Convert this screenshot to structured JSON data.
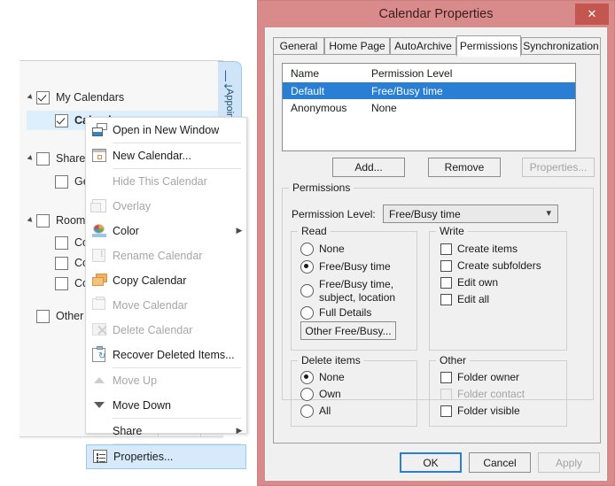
{
  "nav_pane": {
    "peek_tab": {
      "label": "Appointment",
      "arrow_icon": "collapse-left-arrow"
    },
    "tree": [
      {
        "label": "My Calendars",
        "level": 0,
        "expander": true,
        "checked": true,
        "selected": false
      },
      {
        "label": "Calendar",
        "level": 1,
        "expander": false,
        "checked": true,
        "selected": true
      },
      {
        "label": "Shared C",
        "level": 0,
        "expander": true,
        "checked": false,
        "selected": false
      },
      {
        "label": "Geme",
        "level": 1,
        "expander": false,
        "checked": false,
        "selected": false
      },
      {
        "label": "Rooms",
        "level": 0,
        "expander": true,
        "checked": false,
        "selected": false
      },
      {
        "label": "Conf",
        "level": 1,
        "expander": false,
        "checked": false,
        "selected": false
      },
      {
        "label": "Conf",
        "level": 1,
        "expander": false,
        "checked": false,
        "selected": false
      },
      {
        "label": "Conf",
        "level": 1,
        "expander": false,
        "checked": false,
        "selected": false
      },
      {
        "label": "Other Ca",
        "level": 0,
        "expander": false,
        "checked": false,
        "selected": false
      }
    ]
  },
  "context_menu": {
    "items": [
      {
        "label": "Open in New Window",
        "icon": "open-in-new-window-icon",
        "enabled": true,
        "submenu": false,
        "highlight": false
      },
      {
        "label": "New Calendar...",
        "icon": "new-calendar-icon",
        "enabled": true,
        "submenu": false,
        "highlight": false
      },
      {
        "label": "Hide This Calendar",
        "icon": "none",
        "enabled": false,
        "submenu": false,
        "highlight": false
      },
      {
        "label": "Overlay",
        "icon": "overlay-icon",
        "enabled": false,
        "submenu": false,
        "highlight": false
      },
      {
        "label": "Color",
        "icon": "color-palette-icon",
        "enabled": true,
        "submenu": true,
        "highlight": false
      },
      {
        "label": "Rename Calendar",
        "icon": "rename-icon",
        "enabled": false,
        "submenu": false,
        "highlight": false
      },
      {
        "label": "Copy Calendar",
        "icon": "copy-folder-icon",
        "enabled": true,
        "submenu": false,
        "highlight": false
      },
      {
        "label": "Move Calendar",
        "icon": "move-folder-icon",
        "enabled": false,
        "submenu": false,
        "highlight": false
      },
      {
        "label": "Delete Calendar",
        "icon": "delete-folder-icon",
        "enabled": false,
        "submenu": false,
        "highlight": false
      },
      {
        "label": "Recover Deleted Items...",
        "icon": "recover-deleted-icon",
        "enabled": true,
        "submenu": false,
        "highlight": false
      },
      {
        "label": "Move Up",
        "icon": "move-up-icon",
        "enabled": false,
        "submenu": false,
        "highlight": false
      },
      {
        "label": "Move Down",
        "icon": "move-down-icon",
        "enabled": true,
        "submenu": false,
        "highlight": false
      },
      {
        "label": "Share",
        "icon": "none",
        "enabled": true,
        "submenu": true,
        "highlight": false
      },
      {
        "label": "Properties...",
        "icon": "properties-icon",
        "enabled": true,
        "submenu": false,
        "highlight": true
      }
    ]
  },
  "dialog": {
    "title": "Calendar Properties",
    "close_icon": "close-x-icon",
    "frame_color": "#d98b8b",
    "close_button_color": "#c5564f",
    "tabs": [
      {
        "label": "General",
        "active": false
      },
      {
        "label": "Home Page",
        "active": false
      },
      {
        "label": "AutoArchive",
        "active": false
      },
      {
        "label": "Permissions",
        "active": true
      },
      {
        "label": "Synchronization",
        "active": false
      }
    ],
    "permission_list": {
      "columns": [
        "Name",
        "Permission Level"
      ],
      "rows": [
        {
          "name": "Default",
          "level": "Free/Busy time",
          "selected": true
        },
        {
          "name": "Anonymous",
          "level": "None",
          "selected": false
        }
      ],
      "selection_color": "#2a7fd4"
    },
    "list_buttons": [
      {
        "label": "Add...",
        "enabled": true
      },
      {
        "label": "Remove",
        "enabled": true
      },
      {
        "label": "Properties...",
        "enabled": false
      }
    ],
    "permissions_group": {
      "legend": "Permissions",
      "level_label": "Permission Level:",
      "level_value": "Free/Busy time",
      "level_chevron_icon": "chevron-down-icon",
      "read": {
        "legend": "Read",
        "options": [
          {
            "label": "None",
            "selected": false
          },
          {
            "label": "Free/Busy time",
            "selected": true
          },
          {
            "label": "Free/Busy time, subject, location",
            "selected": false
          },
          {
            "label": "Full Details",
            "selected": false
          }
        ],
        "other_button": {
          "label": "Other Free/Busy...",
          "enabled": true
        }
      },
      "write": {
        "legend": "Write",
        "options": [
          {
            "label": "Create items",
            "checked": false,
            "enabled": true
          },
          {
            "label": "Create subfolders",
            "checked": false,
            "enabled": true
          },
          {
            "label": "Edit own",
            "checked": false,
            "enabled": true
          },
          {
            "label": "Edit all",
            "checked": false,
            "enabled": true
          }
        ]
      },
      "delete_items": {
        "legend": "Delete items",
        "options": [
          {
            "label": "None",
            "selected": true
          },
          {
            "label": "Own",
            "selected": false
          },
          {
            "label": "All",
            "selected": false
          }
        ]
      },
      "other": {
        "legend": "Other",
        "options": [
          {
            "label": "Folder owner",
            "checked": false,
            "enabled": true
          },
          {
            "label": "Folder contact",
            "checked": false,
            "enabled": false
          },
          {
            "label": "Folder visible",
            "checked": false,
            "enabled": true
          }
        ]
      }
    },
    "footer_buttons": [
      {
        "label": "OK",
        "enabled": true,
        "default": true
      },
      {
        "label": "Cancel",
        "enabled": true,
        "default": false
      },
      {
        "label": "Apply",
        "enabled": false,
        "default": false
      }
    ]
  }
}
